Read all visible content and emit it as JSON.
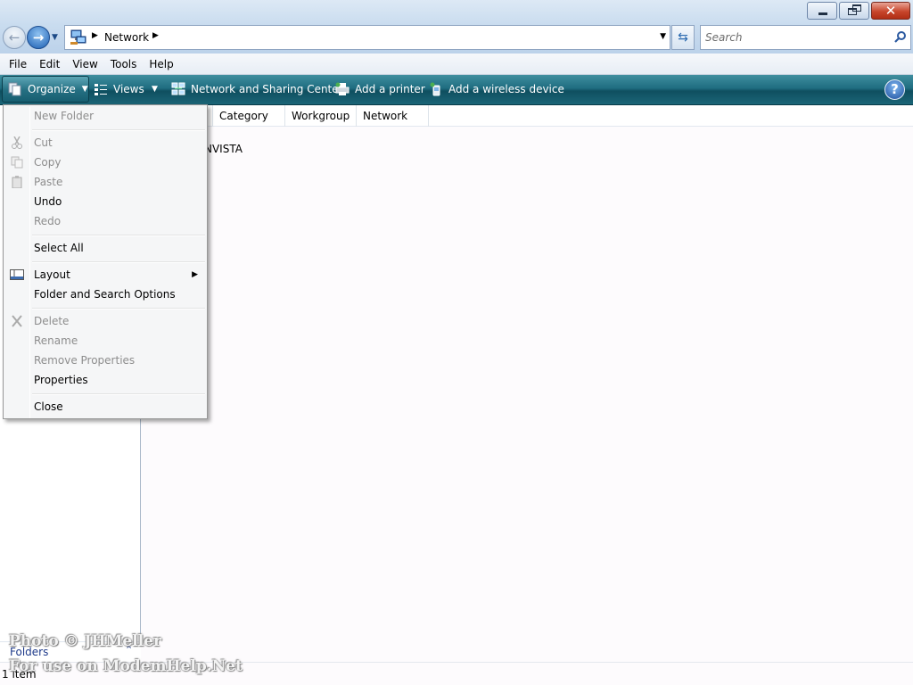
{
  "window": {
    "minimize_icon": "minimize-icon",
    "restore_icon": "restore-icon",
    "close_glyph": "✕"
  },
  "navigation": {
    "back_glyph": "←",
    "forward_glyph": "→",
    "address_segments": [
      "Network"
    ],
    "search_placeholder": "Search"
  },
  "menubar": {
    "items": [
      "File",
      "Edit",
      "View",
      "Tools",
      "Help"
    ]
  },
  "commandbar": {
    "organize": "Organize",
    "views": "Views",
    "network_sharing_center": "Network and Sharing Center",
    "add_printer": "Add a printer",
    "add_wireless": "Add a wireless device",
    "help_glyph": "?"
  },
  "columns": {
    "category": "Category",
    "workgroup": "Workgroup",
    "network_location": "Network lo..."
  },
  "items": [
    {
      "name": "NVISTA"
    }
  ],
  "navpane": {
    "folders_label": "Folders"
  },
  "status": {
    "item_count": "1 item"
  },
  "organize_menu": {
    "new_folder": "New Folder",
    "cut": "Cut",
    "copy": "Copy",
    "paste": "Paste",
    "undo": "Undo",
    "redo": "Redo",
    "select_all": "Select All",
    "layout": "Layout",
    "folder_search_options": "Folder and Search Options",
    "delete": "Delete",
    "rename": "Rename",
    "remove_properties": "Remove Properties",
    "properties": "Properties",
    "close": "Close"
  },
  "watermark": {
    "line1": "Photo © JHMeller",
    "line2": "For use on ModemHelp.Net"
  },
  "colors": {
    "command_bar": "#1f6d80",
    "title_bar": "#c9dcef",
    "disabled_text": "#8d8d8d"
  }
}
